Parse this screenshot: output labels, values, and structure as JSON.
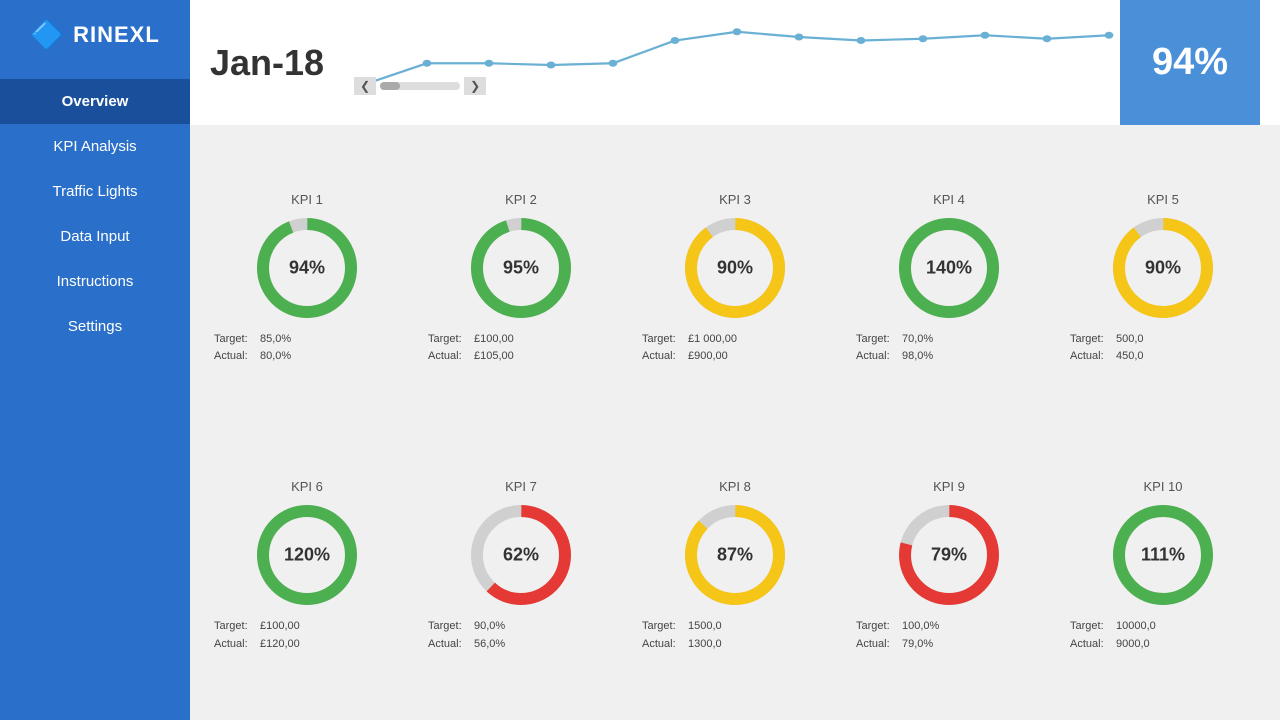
{
  "sidebar": {
    "logo": "RINEXL",
    "nav_items": [
      {
        "id": "overview",
        "label": "Overview",
        "active": true
      },
      {
        "id": "kpi-analysis",
        "label": "KPI Analysis",
        "active": false
      },
      {
        "id": "traffic-lights",
        "label": "Traffic Lights",
        "active": false
      },
      {
        "id": "data-input",
        "label": "Data Input",
        "active": false
      },
      {
        "id": "instructions",
        "label": "Instructions",
        "active": false
      },
      {
        "id": "settings",
        "label": "Settings",
        "active": false
      }
    ]
  },
  "header": {
    "date": "Jan-18",
    "percent": "94%"
  },
  "kpis": [
    {
      "id": "kpi1",
      "title": "KPI 1",
      "percent": 94,
      "label": "94%",
      "color": "#4caf50",
      "bg": "#e8e8e8",
      "target_label": "Target:",
      "target_value": "85,0%",
      "actual_label": "Actual:",
      "actual_value": "80,0%"
    },
    {
      "id": "kpi2",
      "title": "KPI 2",
      "percent": 95,
      "label": "95%",
      "color": "#4caf50",
      "bg": "#e8e8e8",
      "target_label": "Target:",
      "target_value": "£100,00",
      "actual_label": "Actual:",
      "actual_value": "£105,00"
    },
    {
      "id": "kpi3",
      "title": "KPI 3",
      "percent": 90,
      "label": "90%",
      "color": "#f5c518",
      "bg": "#e8e8e8",
      "target_label": "Target:",
      "target_value": "£1 000,00",
      "actual_label": "Actual:",
      "actual_value": "£900,00"
    },
    {
      "id": "kpi4",
      "title": "KPI 4",
      "percent": 100,
      "label": "140%",
      "color": "#4caf50",
      "bg": "#e8e8e8",
      "target_label": "Target:",
      "target_value": "70,0%",
      "actual_label": "Actual:",
      "actual_value": "98,0%"
    },
    {
      "id": "kpi5",
      "title": "KPI 5",
      "percent": 90,
      "label": "90%",
      "color": "#f5c518",
      "bg": "#e8e8e8",
      "target_label": "Target:",
      "target_value": "500,0",
      "actual_label": "Actual:",
      "actual_value": "450,0"
    },
    {
      "id": "kpi6",
      "title": "KPI 6",
      "percent": 100,
      "label": "120%",
      "color": "#4caf50",
      "bg": "#e8e8e8",
      "target_label": "Target:",
      "target_value": "£100,00",
      "actual_label": "Actual:",
      "actual_value": "£120,00"
    },
    {
      "id": "kpi7",
      "title": "KPI 7",
      "percent": 62,
      "label": "62%",
      "color": "#e53935",
      "bg": "#e8e8e8",
      "target_label": "Target:",
      "target_value": "90,0%",
      "actual_label": "Actual:",
      "actual_value": "56,0%"
    },
    {
      "id": "kpi8",
      "title": "KPI 8",
      "percent": 87,
      "label": "87%",
      "color": "#f5c518",
      "bg": "#e8e8e8",
      "target_label": "Target:",
      "target_value": "1500,0",
      "actual_label": "Actual:",
      "actual_value": "1300,0"
    },
    {
      "id": "kpi9",
      "title": "KPI 9",
      "percent": 79,
      "label": "79%",
      "color": "#e53935",
      "bg": "#e8e8e8",
      "target_label": "Target:",
      "target_value": "100,0%",
      "actual_label": "Actual:",
      "actual_value": "79,0%"
    },
    {
      "id": "kpi10",
      "title": "KPI 10",
      "percent": 100,
      "label": "111%",
      "color": "#4caf50",
      "bg": "#e8e8e8",
      "target_label": "Target:",
      "target_value": "10000,0",
      "actual_label": "Actual:",
      "actual_value": "9000,0"
    }
  ],
  "chart": {
    "points": [
      430,
      490,
      490,
      485,
      490,
      555,
      580,
      565,
      555,
      560,
      570,
      560,
      570
    ],
    "color": "#6ab0d4"
  }
}
